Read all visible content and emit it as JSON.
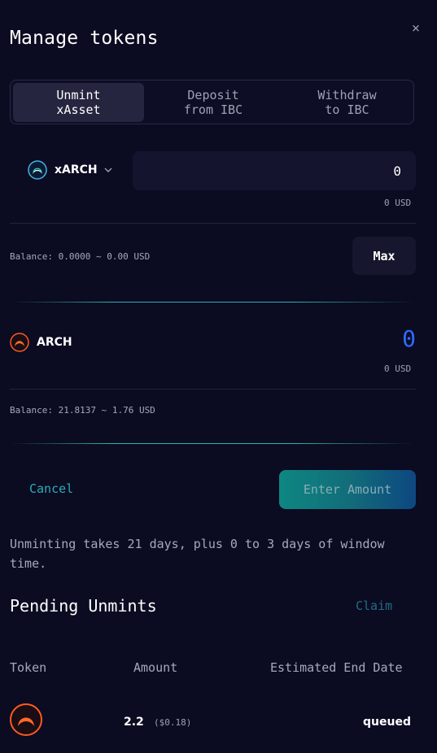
{
  "modal": {
    "title": "Manage tokens",
    "close_icon": "×"
  },
  "tabs": [
    {
      "label": "Unmint\nxAsset",
      "active": true
    },
    {
      "label": "Deposit\nfrom IBC",
      "active": false
    },
    {
      "label": "Withdraw\nto IBC",
      "active": false
    }
  ],
  "from": {
    "token": "xARCH",
    "token_icon": "xarch-logo-icon",
    "amount_value": "0",
    "amount_usd": "0 USD",
    "balance": "Balance: 0.0000 ~ 0.00 USD",
    "max_label": "Max"
  },
  "to": {
    "token": "ARCH",
    "token_icon": "arch-logo-icon",
    "amount_value": "0",
    "amount_usd": "0 USD",
    "balance": "Balance: 21.8137 ~ 1.76 USD"
  },
  "actions": {
    "cancel_label": "Cancel",
    "submit_label": "Enter Amount"
  },
  "note": "Unminting takes 21 days, plus 0 to 3 days of window time.",
  "pending": {
    "title": "Pending Unmints",
    "claim_label": "Claim",
    "columns": [
      "Token",
      "Amount",
      "Estimated End Date"
    ],
    "rows": [
      {
        "token_icon": "arch-logo-icon",
        "amount": "2.2",
        "amount_usd": "($0.18)",
        "end_date": "queued"
      }
    ]
  },
  "colors": {
    "background": "#0b0b22",
    "accent_teal": "#2bd3c6",
    "accent_blue": "#2f6bff",
    "arch_orange": "#ff5a1f"
  }
}
